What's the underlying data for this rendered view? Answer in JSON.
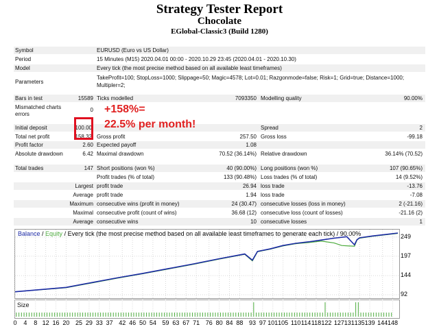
{
  "report": {
    "title": "Strategy Tester Report",
    "subtitle": "Chocolate",
    "build": "EGlobal-Classic3 (Build 1280)"
  },
  "settings": [
    {
      "label": "Symbol",
      "value": "EURUSD (Euro vs US Dollar)"
    },
    {
      "label": "Period",
      "value": "15 Minutes (M15) 2020.04.01 00:00 - 2020.10.29 23:45 (2020.04.01 - 2020.10.30)"
    },
    {
      "label": "Model",
      "value": "Every tick (the most precise method based on all available least timeframes)"
    },
    {
      "label": "Parameters",
      "value_line1": "TakeProfit=100; StopLoss=1000; Slippage=50; Magic=4578; Lot=0.01; Razgonmode=false; Risk=1; Grid=true; Distance=1000;",
      "value_line2": "Multipler=2;"
    }
  ],
  "stats": {
    "bars_label": "Bars in test",
    "bars_value": "15589",
    "ticks_label": "Ticks modelled",
    "ticks_value": "7093350",
    "quality_label": "Modelling quality",
    "quality_value": "90.00%",
    "mismatch_label_1": "Mismatched charts",
    "mismatch_label_2": "errors",
    "mismatch_value": "0",
    "deposit_label": "Initial deposit",
    "deposit_value": "100.00",
    "spread_label": "Spread",
    "spread_value": "2",
    "net_label": "Total net profit",
    "net_value": "158.32",
    "gross_profit_label": "Gross profit",
    "gross_profit_value": "257.50",
    "gross_loss_label": "Gross loss",
    "gross_loss_value": "-99.18",
    "pf_label": "Profit factor",
    "pf_value": "2.60",
    "payoff_label": "Expected payoff",
    "payoff_value": "1.08",
    "abs_dd_label": "Absolute drawdown",
    "abs_dd_value": "6.42",
    "max_dd_label": "Maximal drawdown",
    "max_dd_value": "70.52 (36.14%)",
    "rel_dd_label": "Relative drawdown",
    "rel_dd_value": "36.14% (70.52)",
    "trades_label": "Total trades",
    "trades_value": "147",
    "short_label": "Short positions (won %)",
    "short_value": "40 (90.00%)",
    "long_label": "Long positions (won %)",
    "long_value": "107 (90.65%)",
    "pt_label": "Profit trades (% of total)",
    "pt_value": "133 (90.48%)",
    "lt_label": "Loss trades (% of total)",
    "lt_value": "14 (9.52%)",
    "largest": "Largest",
    "average": "Average",
    "maximum": "Maximum",
    "maximal": "Maximal",
    "profit_trade": "profit trade",
    "loss_trade": "loss trade",
    "largest_profit": "26.94",
    "largest_loss": "-13.76",
    "average_profit": "1.94",
    "average_loss": "-7.08",
    "cw_money_label": "consecutive wins (profit in money)",
    "cw_money_value": "24 (30.47)",
    "cl_money_label": "consecutive losses (loss in money)",
    "cl_money_value": "2 (-21.16)",
    "cp_count_label": "consecutive profit (count of wins)",
    "cp_count_value": "36.68 (12)",
    "cl_count_label": "consecutive loss (count of losses)",
    "cl_count_value": "-21.16 (2)",
    "cons_wins_label": "consecutive wins",
    "cons_wins_value": "10",
    "cons_losses_label": "consecutive losses",
    "cons_losses_value": "1"
  },
  "annotation": {
    "line1": "+158%=",
    "line2": "22.5% per month!",
    "color": "#e02020"
  },
  "chart": {
    "legend_balance": "Balance",
    "legend_sep": " / ",
    "legend_equity": "Equity",
    "legend_rest": " / Every tick (the most precise method based on all available least timeframes to generate each tick) / 90.00%",
    "size_label": "Size",
    "colors": {
      "balance": "#1c2aa6",
      "equity": "#4aaa3a",
      "size": "#4aaa3a"
    }
  },
  "chart_data": {
    "type": "line",
    "x_ticks": [
      0,
      4,
      8,
      12,
      16,
      20,
      25,
      29,
      33,
      37,
      42,
      46,
      50,
      54,
      59,
      63,
      67,
      71,
      76,
      80,
      84,
      88,
      93,
      97,
      101,
      105,
      110,
      114,
      118,
      122,
      127,
      131,
      135,
      139,
      144,
      148
    ],
    "y_ticks": [
      92,
      144,
      197,
      249
    ],
    "ylim": [
      92,
      260
    ],
    "xlim": [
      0,
      150
    ],
    "series": [
      {
        "name": "Balance",
        "x": [
          0,
          20,
          30,
          40,
          50,
          60,
          70,
          80,
          90,
          93,
          95,
          100,
          105,
          110,
          115,
          120,
          125,
          130,
          133,
          134,
          135,
          140,
          145,
          150
        ],
        "y": [
          100,
          112,
          125,
          138,
          150,
          163,
          176,
          190,
          203,
          186,
          210,
          217,
          226,
          232,
          236,
          241,
          246,
          250,
          228,
          242,
          247,
          252,
          256,
          260
        ]
      },
      {
        "name": "Equity",
        "x": [
          0,
          20,
          30,
          40,
          50,
          60,
          70,
          80,
          90,
          93,
          95,
          100,
          105,
          110,
          115,
          120,
          125,
          128,
          133,
          134,
          135,
          140,
          145,
          150
        ],
        "y": [
          100,
          111,
          124,
          137,
          149,
          162,
          175,
          189,
          202,
          184,
          209,
          216,
          225,
          231,
          234,
          238,
          233,
          226,
          224,
          241,
          246,
          251,
          255,
          259
        ]
      }
    ]
  }
}
